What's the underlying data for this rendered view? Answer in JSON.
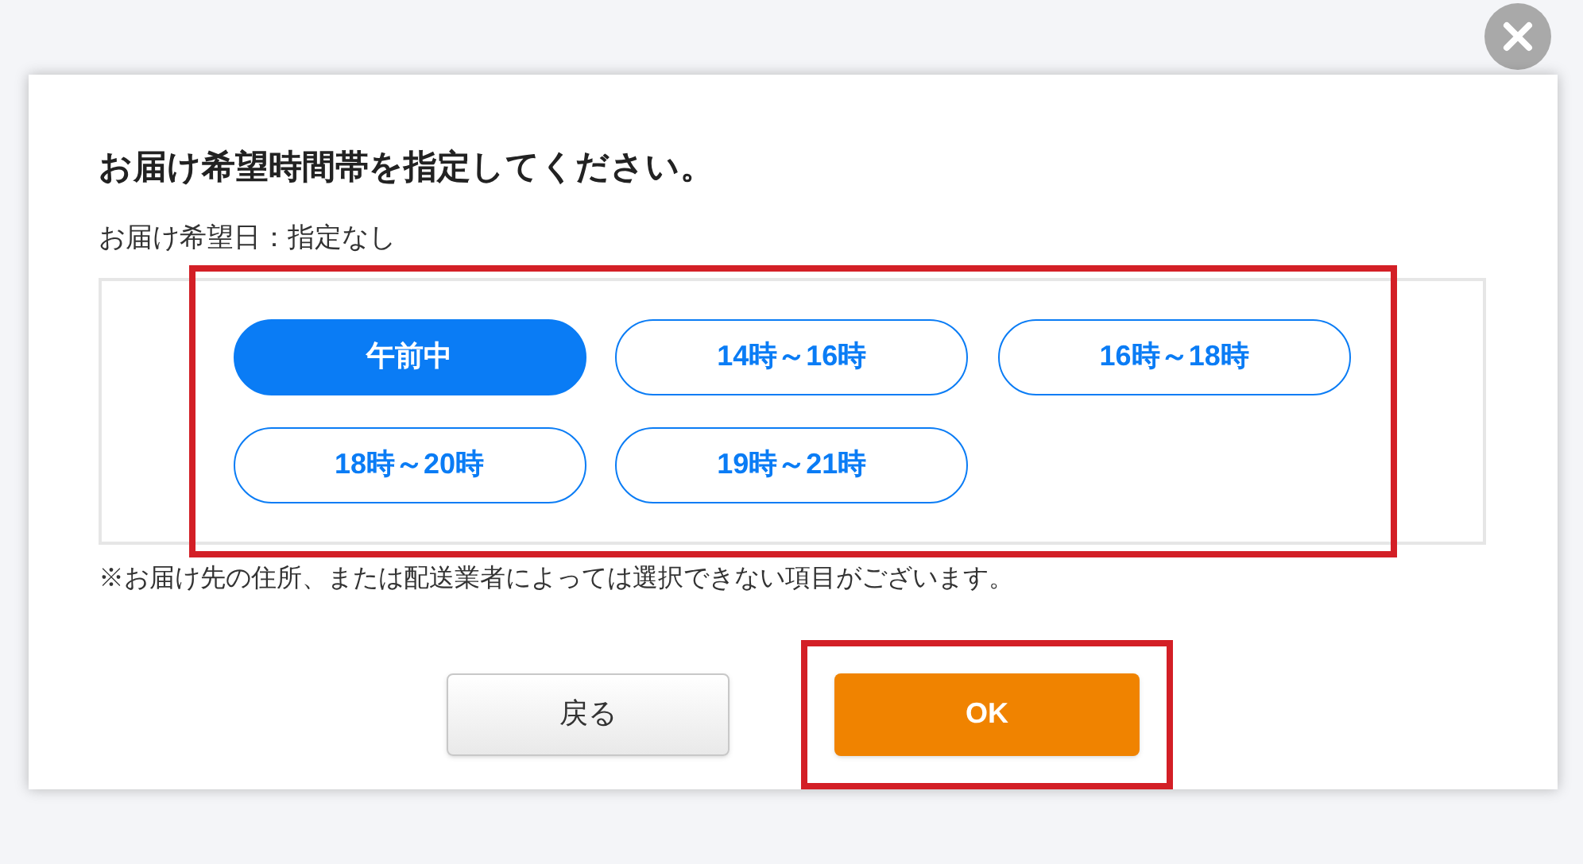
{
  "dialog": {
    "title": "お届け希望時間帯を指定してください。",
    "date_line": "お届け希望日：指定なし",
    "time_slots": [
      {
        "label": "午前中",
        "selected": true
      },
      {
        "label": "14時～16時",
        "selected": false
      },
      {
        "label": "16時～18時",
        "selected": false
      },
      {
        "label": "18時～20時",
        "selected": false
      },
      {
        "label": "19時～21時",
        "selected": false
      }
    ],
    "note": "※お届け先の住所、または配送業者によっては選択できない項目がございます。",
    "buttons": [
      {
        "kind": "back",
        "label": "戻る",
        "highlighted": false
      },
      {
        "kind": "ok",
        "label": "OK",
        "highlighted": true
      }
    ],
    "slots_highlighted": true
  }
}
